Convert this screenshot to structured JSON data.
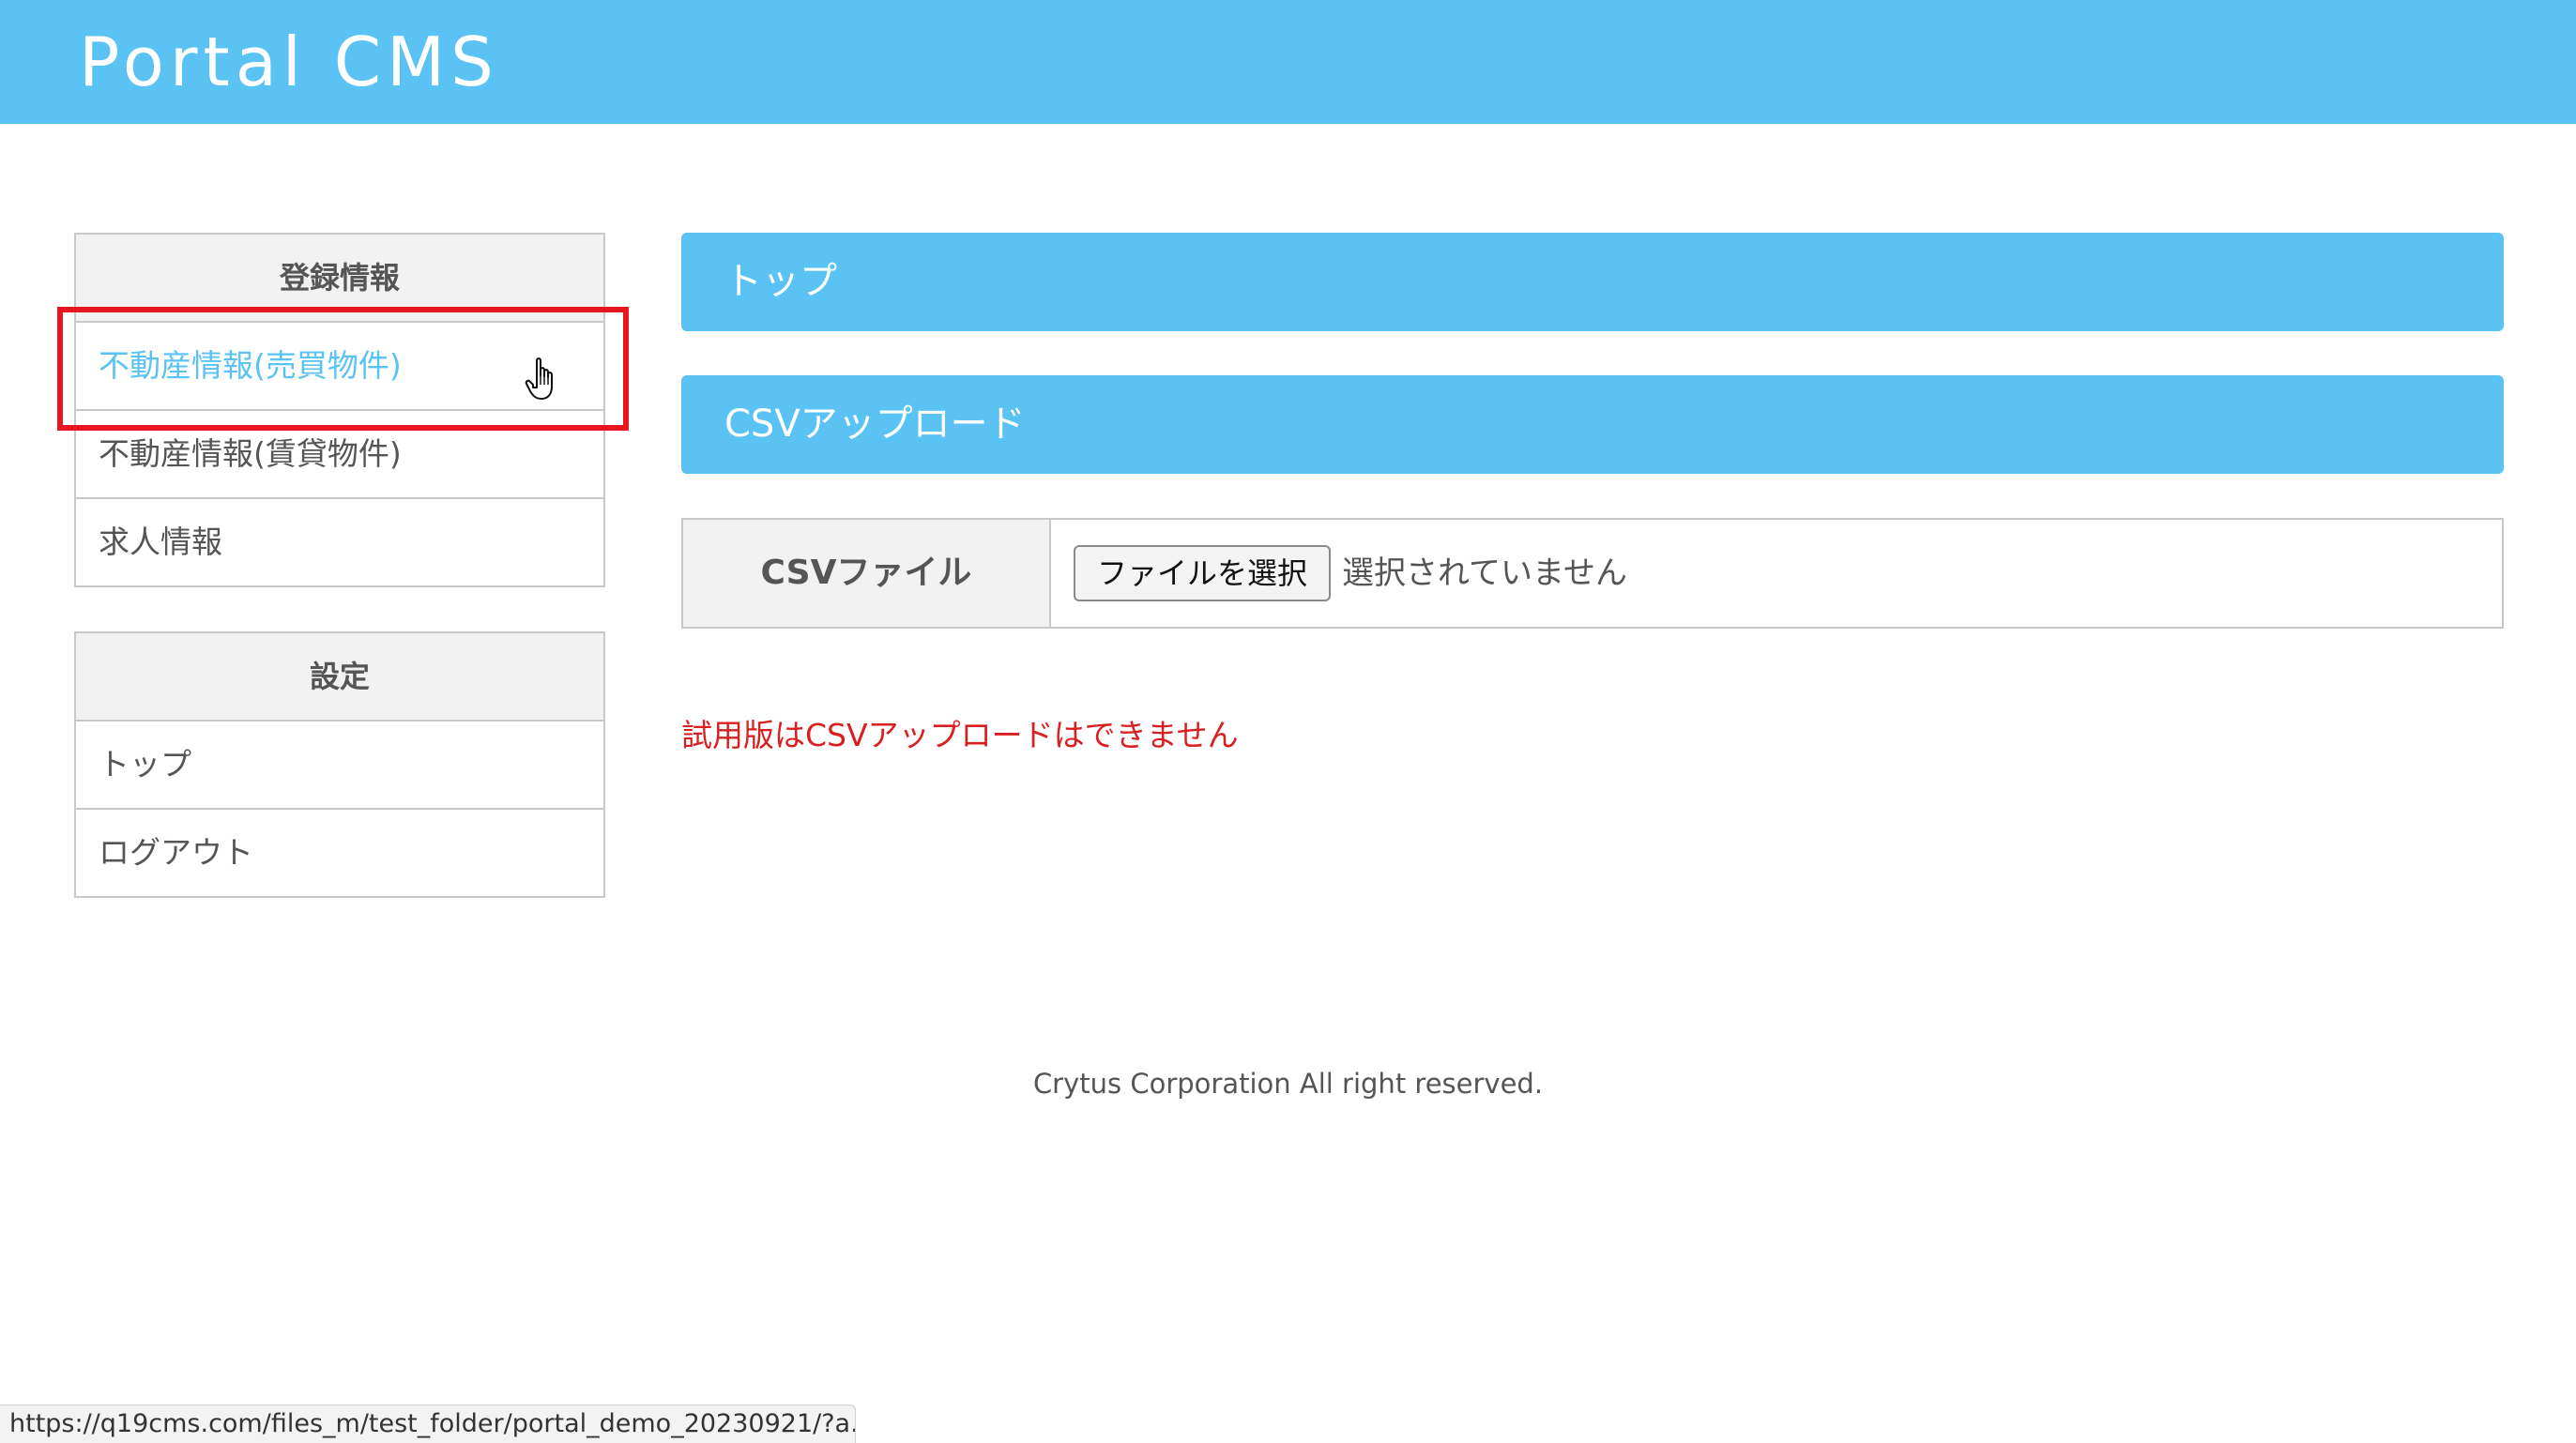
{
  "header": {
    "title": "Portal CMS"
  },
  "sidebar": {
    "registration": {
      "heading": "登録情報",
      "items": [
        {
          "label": "不動産情報(売買物件)"
        },
        {
          "label": "不動産情報(賃貸物件)"
        },
        {
          "label": "求人情報"
        }
      ]
    },
    "settings": {
      "heading": "設定",
      "items": [
        {
          "label": "トップ"
        },
        {
          "label": "ログアウト"
        }
      ]
    }
  },
  "main": {
    "top_bar": "トップ",
    "csv_bar": "CSVアップロード",
    "form": {
      "label": "CSVファイル",
      "choose_button": "ファイルを選択",
      "status": "選択されていません"
    },
    "error": "試用版はCSVアップロードはできません"
  },
  "footer": {
    "text": "Crytus Corporation All right reserved."
  },
  "status_bar": {
    "url": "https://q19cms.com/files_m/test_folder/portal_demo_20230921/?a..."
  },
  "colors": {
    "accent": "#5bc2f4",
    "error": "#d91f1f",
    "highlight": "#e8141e"
  },
  "icons": {
    "cursor": "hand-pointer-icon"
  }
}
